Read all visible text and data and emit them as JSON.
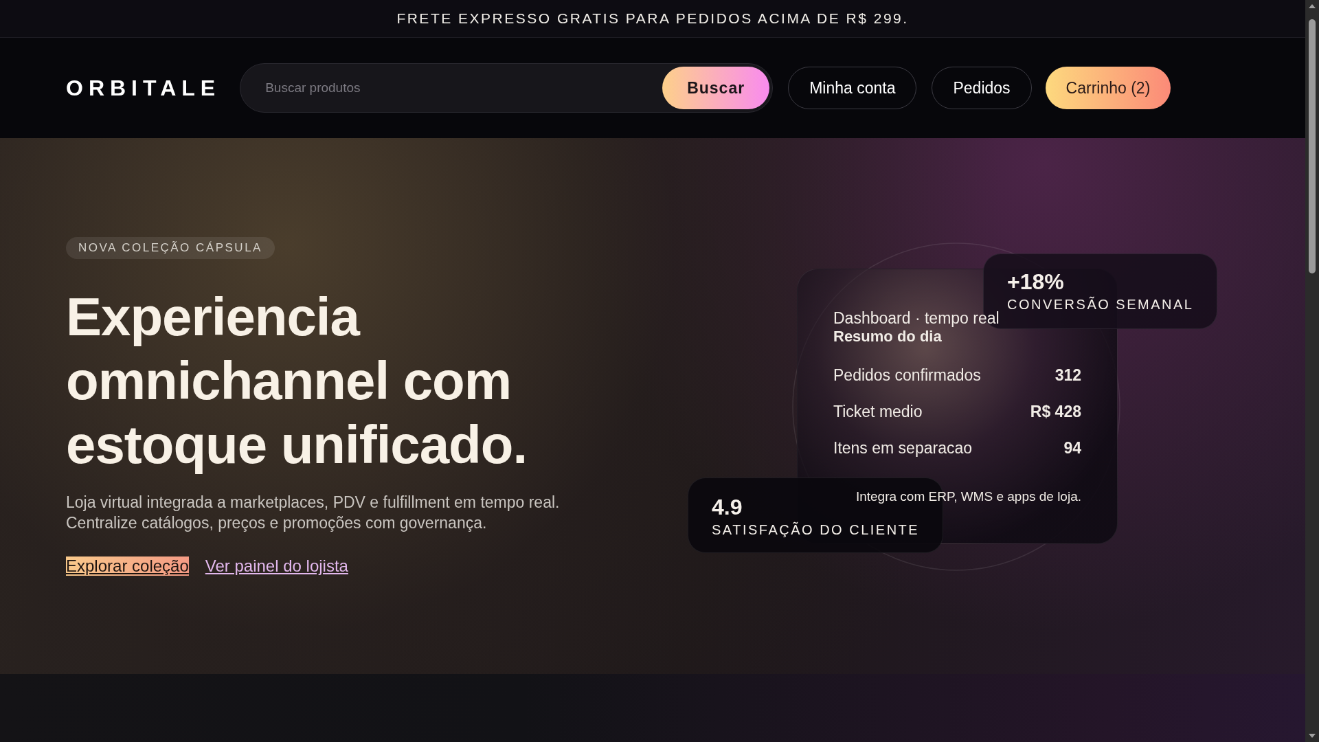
{
  "announcement": "FRETE EXPRESSO GRATIS PARA PEDIDOS ACIMA DE R$ 299.",
  "header": {
    "logo": "ORBITALE",
    "search": {
      "placeholder": "Buscar produtos",
      "button": "Buscar"
    },
    "nav": [
      {
        "label": "Minha conta",
        "kind": "outline"
      },
      {
        "label": "Pedidos",
        "kind": "outline"
      },
      {
        "label": "Carrinho (2)",
        "kind": "primary"
      }
    ]
  },
  "hero": {
    "badge": "NOVA COLEÇÃO CÁPSULA",
    "heading": [
      "Experiencia",
      "omnichannel com",
      "estoque unificado."
    ],
    "description": [
      "Loja virtual integrada a marketplaces, PDV e fulfillment em tempo real.",
      "Centralize catálogos, preços e promoções com governança."
    ],
    "links": [
      {
        "label": "Explorar coleção",
        "kind": "highlight"
      },
      {
        "label": "Ver painel do lojista",
        "kind": "plain"
      }
    ]
  },
  "dashboard": {
    "eyebrow": "Dashboard · tempo real",
    "title": "Resumo do dia",
    "metrics": [
      {
        "label": "Pedidos confirmados",
        "value": "312"
      },
      {
        "label": "Ticket medio",
        "value": "R$ 428"
      },
      {
        "label": "Itens em separacao",
        "value": "94"
      }
    ],
    "footnote": "Integra com ERP, WMS e apps de loja."
  },
  "stats": [
    {
      "value": "+18%",
      "label": "CONVERSÃO SEMANAL"
    },
    {
      "value": "4.9",
      "label": "SATISFAÇÃO DO CLIENTE"
    }
  ]
}
